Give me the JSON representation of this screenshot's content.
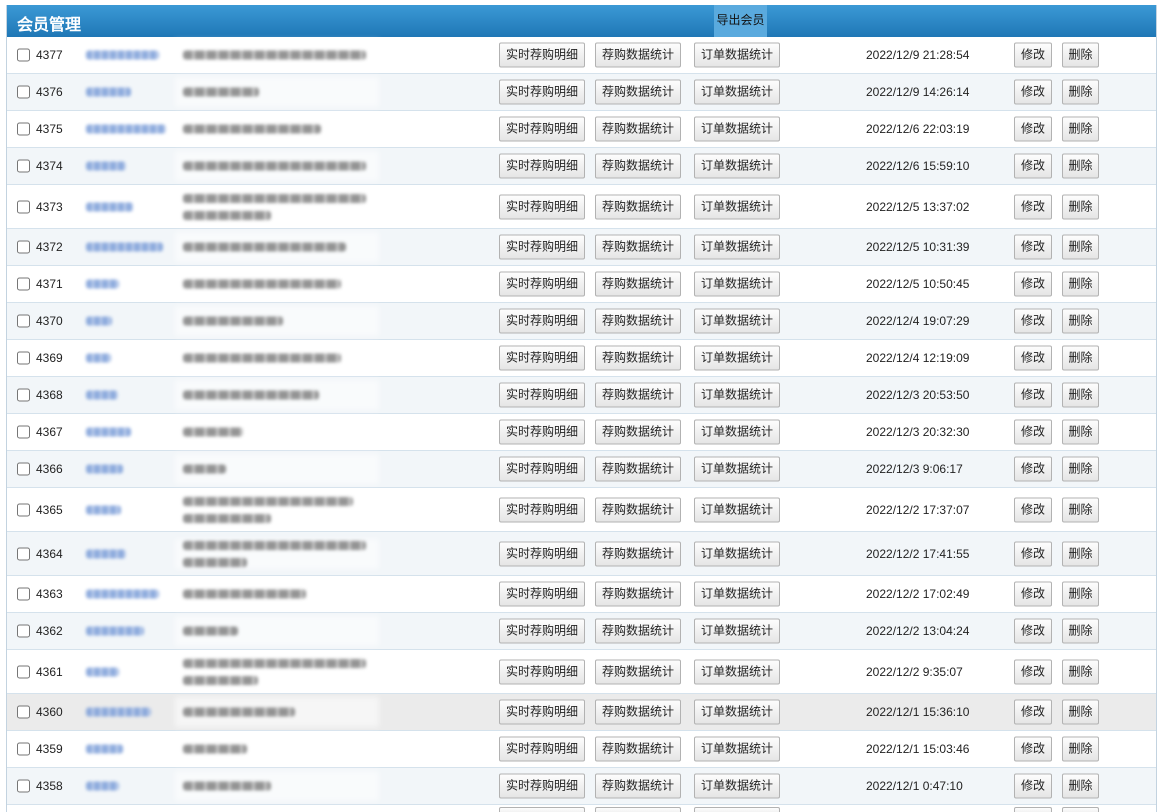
{
  "header": {
    "title": "会员管理",
    "export_label": "导出会员"
  },
  "row_actions": {
    "realtime_label": "实时荐购明细",
    "recommend_stats_label": "荐购数据统计",
    "order_stats_label": "订单数据统计",
    "edit_label": "修改",
    "delete_label": "删除"
  },
  "theme": {
    "header_color": "#2a88c8",
    "row_alt_color": "#f2f6f9",
    "row_hover_color": "#ebebeb"
  },
  "members": [
    {
      "id": "4377",
      "date": "2022/12/9 21:28:54"
    },
    {
      "id": "4376",
      "date": "2022/12/9 14:26:14"
    },
    {
      "id": "4375",
      "date": "2022/12/6 22:03:19"
    },
    {
      "id": "4374",
      "date": "2022/12/6 15:59:10"
    },
    {
      "id": "4373",
      "date": "2022/12/5 13:37:02"
    },
    {
      "id": "4372",
      "date": "2022/12/5 10:31:39"
    },
    {
      "id": "4371",
      "date": "2022/12/5 10:50:45"
    },
    {
      "id": "4370",
      "date": "2022/12/4 19:07:29"
    },
    {
      "id": "4369",
      "date": "2022/12/4 12:19:09"
    },
    {
      "id": "4368",
      "date": "2022/12/3 20:53:50"
    },
    {
      "id": "4367",
      "date": "2022/12/3 20:32:30"
    },
    {
      "id": "4366",
      "date": "2022/12/3 9:06:17"
    },
    {
      "id": "4365",
      "date": "2022/12/2 17:37:07"
    },
    {
      "id": "4364",
      "date": "2022/12/2 17:41:55"
    },
    {
      "id": "4363",
      "date": "2022/12/2 17:02:49"
    },
    {
      "id": "4362",
      "date": "2022/12/2 13:04:24"
    },
    {
      "id": "4361",
      "date": "2022/12/2 9:35:07"
    },
    {
      "id": "4360",
      "date": "2022/12/1 15:36:10"
    },
    {
      "id": "4359",
      "date": "2022/12/1 15:03:46"
    },
    {
      "id": "4358",
      "date": "2022/12/1 0:47:10"
    }
  ]
}
